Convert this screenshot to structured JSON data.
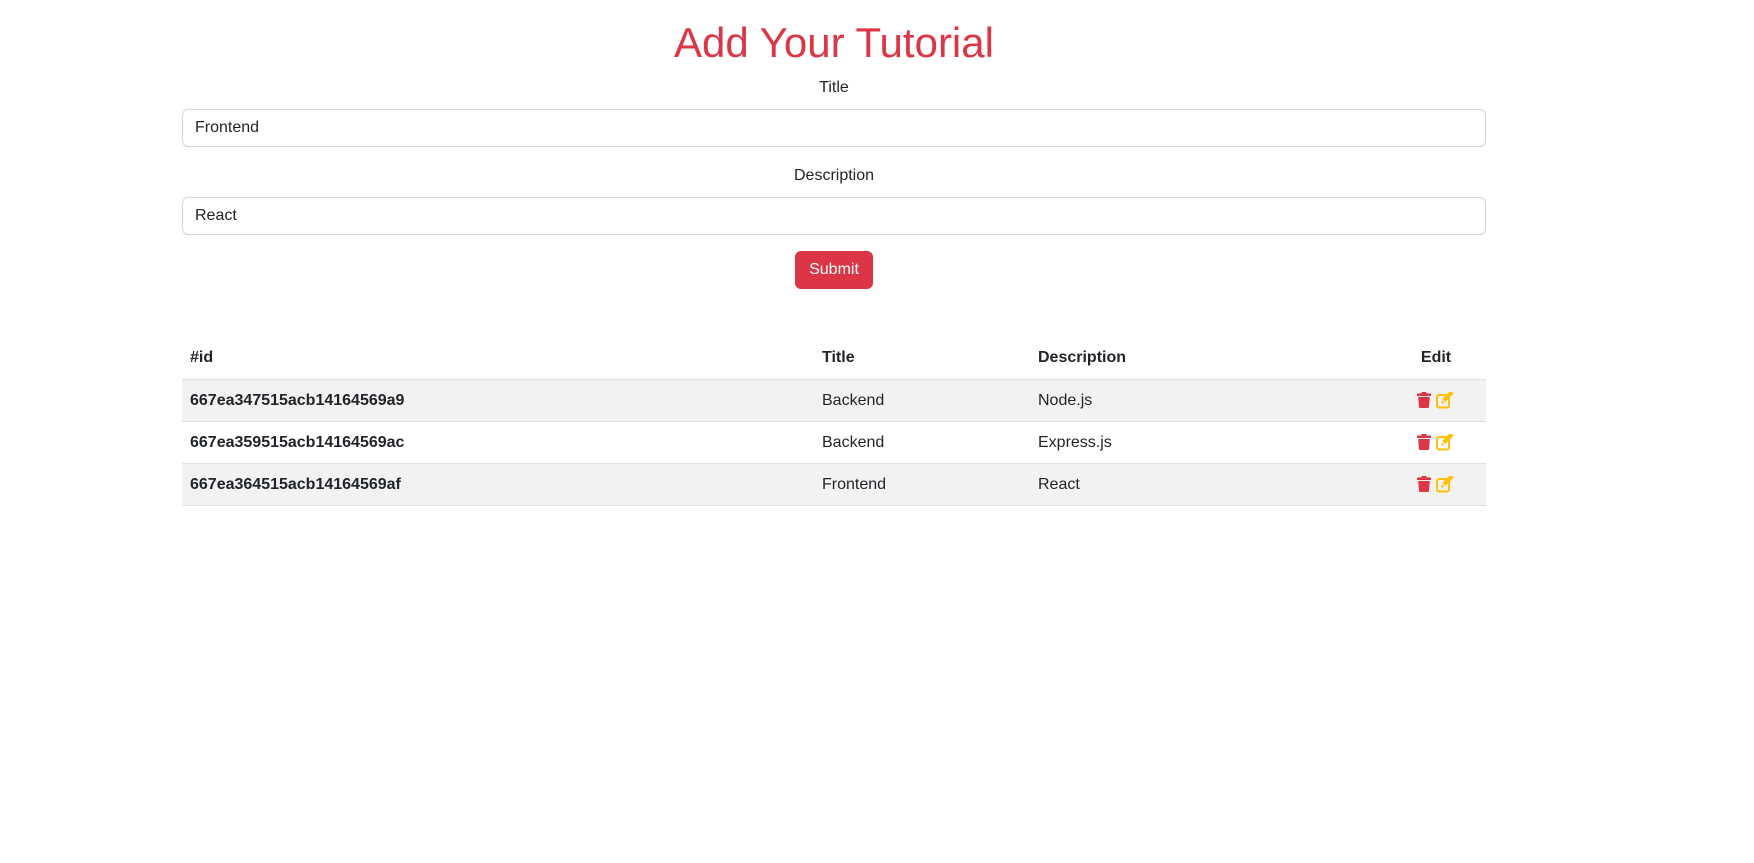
{
  "form": {
    "heading": "Add Your Tutorial",
    "title_label": "Title",
    "title_value": "Frontend",
    "description_label": "Description",
    "description_value": "React",
    "submit_label": "Submit"
  },
  "table": {
    "headers": {
      "id": "#id",
      "title": "Title",
      "description": "Description",
      "edit": "Edit"
    },
    "rows": [
      {
        "id": "667ea347515acb14164569a9",
        "title": "Backend",
        "description": "Node.js"
      },
      {
        "id": "667ea359515acb14164569ac",
        "title": "Backend",
        "description": "Express.js"
      },
      {
        "id": "667ea364515acb14164569af",
        "title": "Frontend",
        "description": "React"
      }
    ]
  },
  "icons": {
    "delete": "trash-icon",
    "edit": "pen-to-square-icon"
  },
  "colors": {
    "accent": "#dc3545",
    "edit_icon": "#ffc107",
    "row_stripe": "#f2f2f2"
  }
}
